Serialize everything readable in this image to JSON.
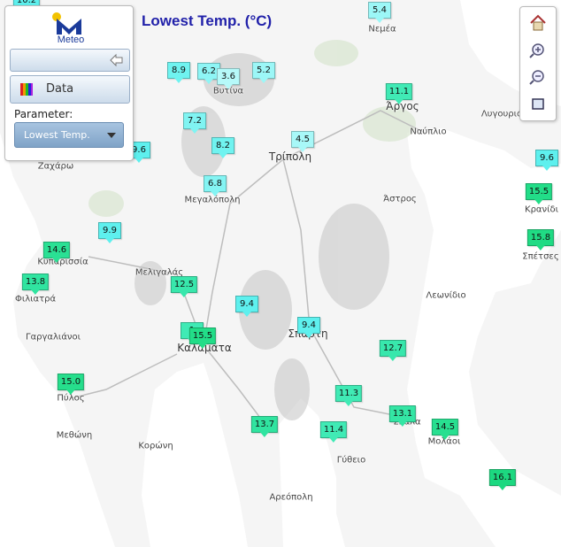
{
  "title": "Lowest Temp. (°C)",
  "panel": {
    "logo_text": "Meteo",
    "data_label": "Data",
    "parameter_label": "Parameter:",
    "parameter_value": "Lowest Temp."
  },
  "toolbar": [
    "home-icon",
    "zoom-in-icon",
    "zoom-out-icon",
    "zoom-extent-icon"
  ],
  "colors": {
    "title": "#2222aa",
    "marker_cool": "#7ff5f5",
    "marker_warm": "#22dd88",
    "sea": "#ffffff",
    "land": "#e8e8e8"
  },
  "places": [
    {
      "name": "Νεμέα"
    },
    {
      "name": "Βυτίνα"
    },
    {
      "name": "Άργος"
    },
    {
      "name": "Ναύπλιο"
    },
    {
      "name": "Λυγουριό"
    },
    {
      "name": "Τρίπολη"
    },
    {
      "name": "Ζαχάρω"
    },
    {
      "name": "Μεγαλόπολη"
    },
    {
      "name": "Άστρος"
    },
    {
      "name": "Κρανίδι"
    },
    {
      "name": "Κυπαρισσία"
    },
    {
      "name": "Μελιγαλάς"
    },
    {
      "name": "Σπέτσες"
    },
    {
      "name": "Φιλιατρά"
    },
    {
      "name": "Λεωνίδιο"
    },
    {
      "name": "Γαργαλιάνοι"
    },
    {
      "name": "Σπάρτη"
    },
    {
      "name": "Καλαμάτα"
    },
    {
      "name": "Πύλος"
    },
    {
      "name": "Μεθώνη"
    },
    {
      "name": "Κορώνη"
    },
    {
      "name": "Σκάλα"
    },
    {
      "name": "Μολάοι"
    },
    {
      "name": "Γύθειο"
    },
    {
      "name": "Αρεόπολη"
    }
  ],
  "markers": [
    {
      "value": "10.2"
    },
    {
      "value": "5.4"
    },
    {
      "value": "8.9"
    },
    {
      "value": "6.2"
    },
    {
      "value": "3.6"
    },
    {
      "value": "5.2"
    },
    {
      "value": "11.1"
    },
    {
      "value": "7.2"
    },
    {
      "value": "9.6"
    },
    {
      "value": "8.2"
    },
    {
      "value": "4.5"
    },
    {
      "value": "9.6"
    },
    {
      "value": "6.8"
    },
    {
      "value": "15.5"
    },
    {
      "value": "9.9"
    },
    {
      "value": "15.8"
    },
    {
      "value": "14.6"
    },
    {
      "value": "13.8"
    },
    {
      "value": "12.5"
    },
    {
      "value": "9.4"
    },
    {
      "value": "9.4"
    },
    {
      "value": "1"
    },
    {
      "value": "15.5"
    },
    {
      "value": "12.7"
    },
    {
      "value": "15.0"
    },
    {
      "value": "11.3"
    },
    {
      "value": "13.1"
    },
    {
      "value": "13.7"
    },
    {
      "value": "11.4"
    },
    {
      "value": "14.5"
    },
    {
      "value": "16.1"
    }
  ]
}
